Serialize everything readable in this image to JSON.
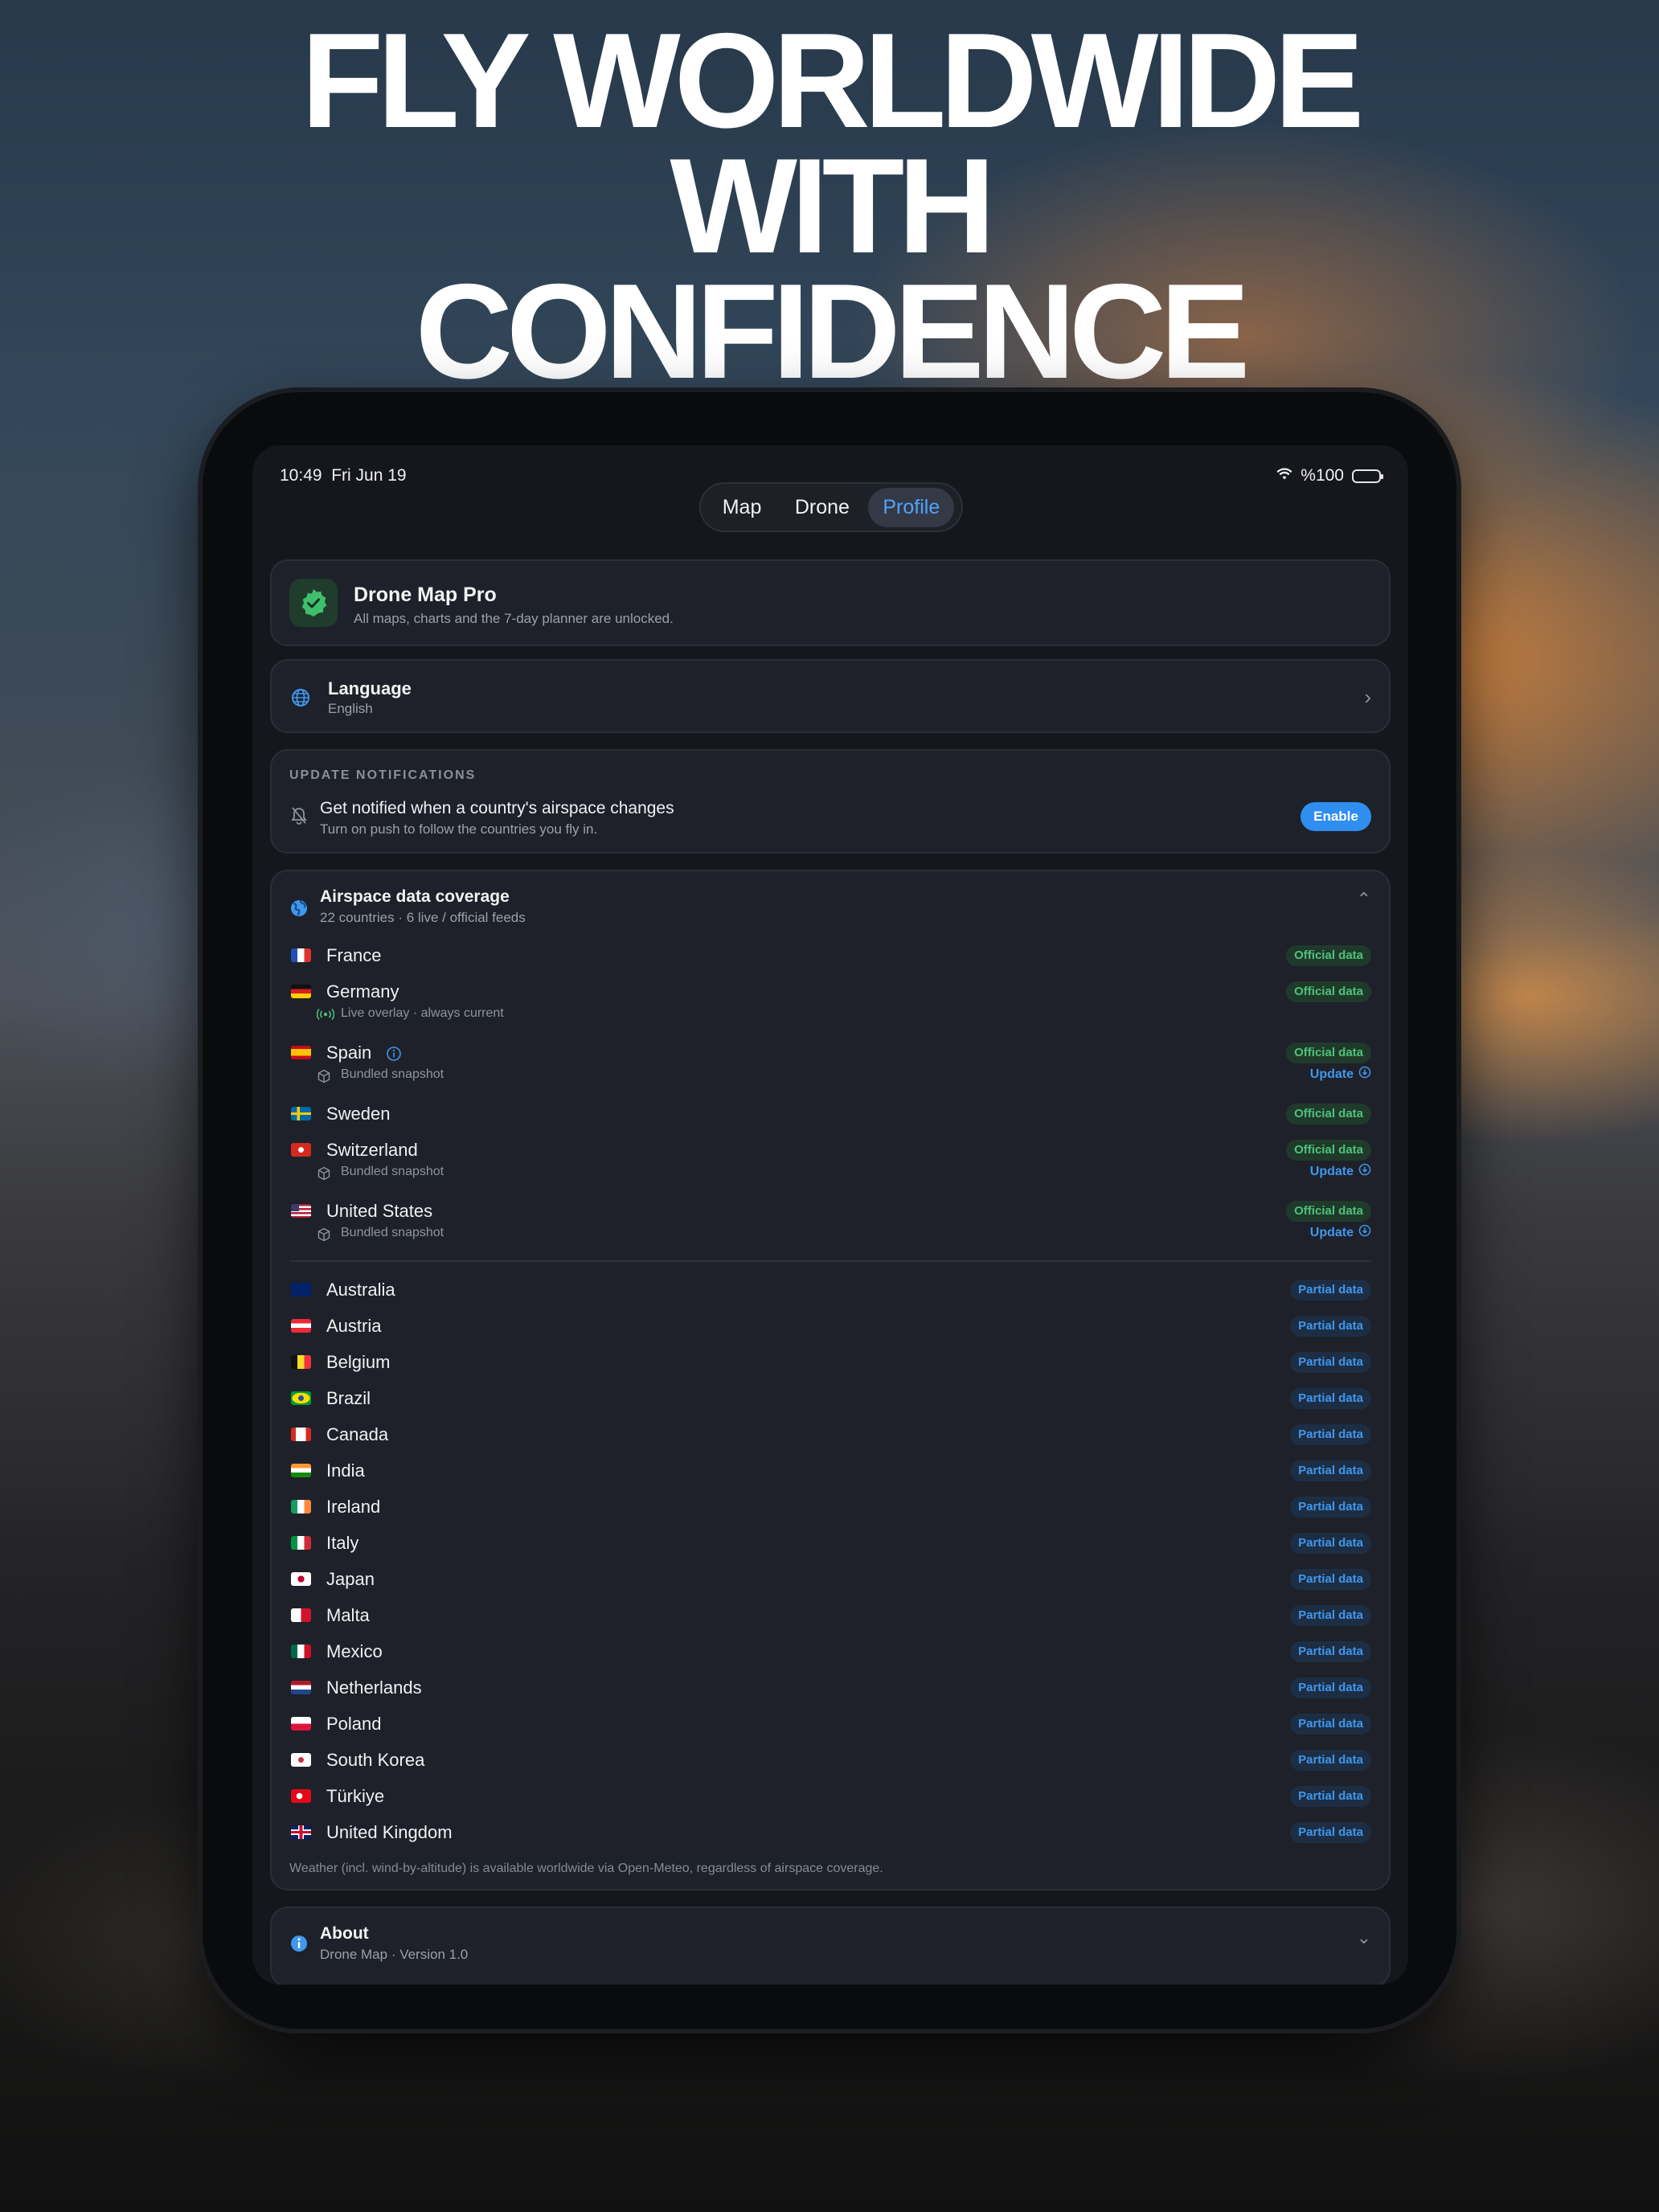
{
  "headline": [
    "FLY WORLDWIDE",
    "WITH",
    "CONFIDENCE"
  ],
  "status": {
    "time": "10:49",
    "date": "Fri Jun 19",
    "battery": "%100"
  },
  "tabs": [
    {
      "label": "Map",
      "active": false
    },
    {
      "label": "Drone",
      "active": false
    },
    {
      "label": "Profile",
      "active": true
    }
  ],
  "pro": {
    "title": "Drone Map Pro",
    "subtitle": "All maps, charts and the 7-day planner are unlocked."
  },
  "language": {
    "title": "Language",
    "value": "English"
  },
  "notifications": {
    "section_label": "UPDATE NOTIFICATIONS",
    "title": "Get notified when a country's airspace changes",
    "subtitle": "Turn on push to follow the countries you fly in.",
    "button": "Enable"
  },
  "coverage": {
    "title": "Airspace data coverage",
    "subtitle": "22 countries · 6 live / official feeds",
    "official_label": "Official data",
    "partial_label": "Partial data",
    "update_label": "Update",
    "official": [
      {
        "name": "France"
      },
      {
        "name": "Germany",
        "note": "Live overlay · always current",
        "note_type": "live"
      },
      {
        "name": "Spain",
        "info": true,
        "note": "Bundled snapshot",
        "note_type": "bundle",
        "update": true
      },
      {
        "name": "Sweden"
      },
      {
        "name": "Switzerland",
        "note": "Bundled snapshot",
        "note_type": "bundle",
        "update": true
      },
      {
        "name": "United States",
        "note": "Bundled snapshot",
        "note_type": "bundle",
        "update": true
      }
    ],
    "partial": [
      {
        "name": "Australia"
      },
      {
        "name": "Austria"
      },
      {
        "name": "Belgium"
      },
      {
        "name": "Brazil"
      },
      {
        "name": "Canada"
      },
      {
        "name": "India"
      },
      {
        "name": "Ireland"
      },
      {
        "name": "Italy"
      },
      {
        "name": "Japan"
      },
      {
        "name": "Malta"
      },
      {
        "name": "Mexico"
      },
      {
        "name": "Netherlands"
      },
      {
        "name": "Poland"
      },
      {
        "name": "South Korea"
      },
      {
        "name": "Türkiye"
      },
      {
        "name": "United Kingdom"
      }
    ],
    "footnote": "Weather (incl. wind-by-altitude) is available worldwide via Open-Meteo, regardless of airspace coverage."
  },
  "about": {
    "title": "About",
    "subtitle": "Drone Map · Version 1.0"
  },
  "colors": {
    "accent": "#3f97ee",
    "success": "#4ec27a",
    "card": "#1e2129"
  }
}
